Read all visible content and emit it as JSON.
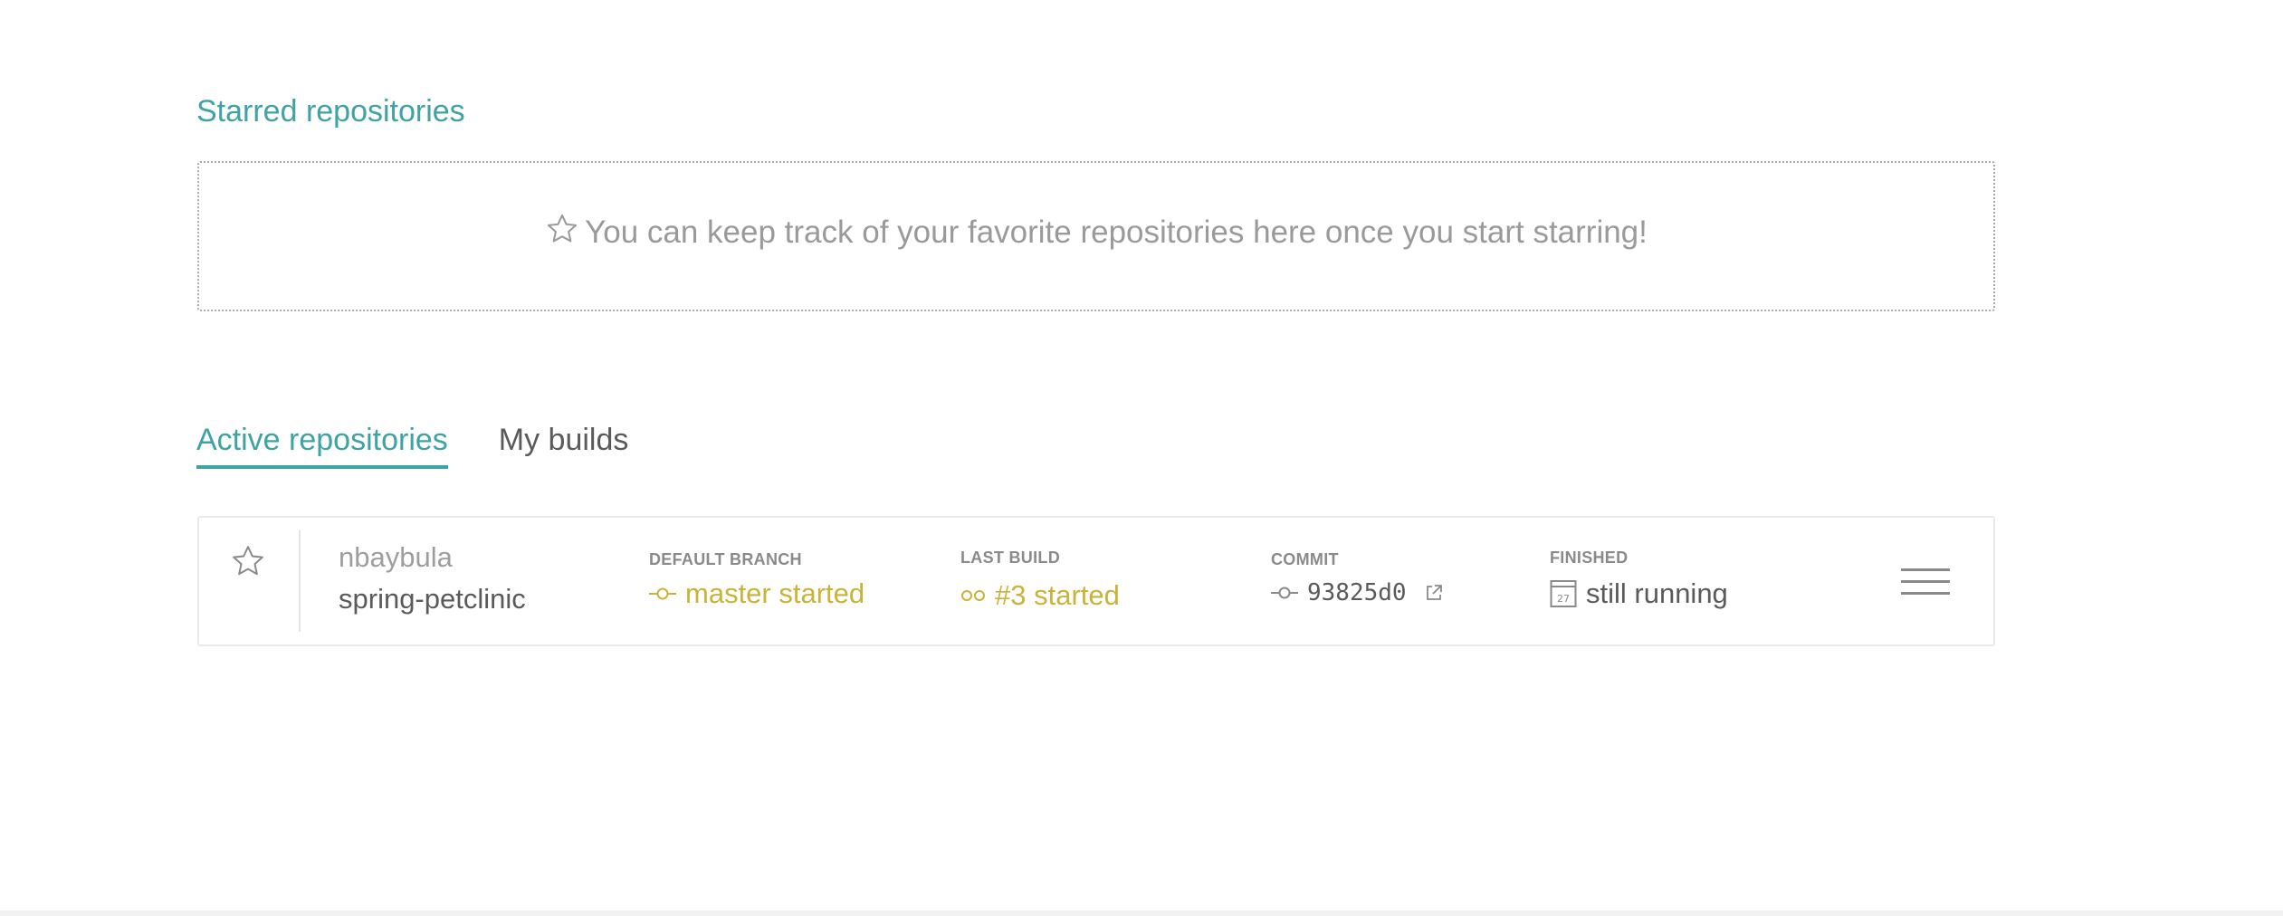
{
  "starred": {
    "title": "Starred repositories",
    "empty_message": "You can keep track of your favorite repositories here once you start starring!"
  },
  "tabs": [
    {
      "label": "Active repositories",
      "active": true
    },
    {
      "label": "My builds",
      "active": false
    }
  ],
  "repository": {
    "owner": "nbaybula",
    "name": "spring-petclinic",
    "default_branch_label": "DEFAULT BRANCH",
    "default_branch_value": "master started",
    "last_build_label": "LAST BUILD",
    "last_build_value": "#3 started",
    "commit_label": "COMMIT",
    "commit_value": "93825d0",
    "finished_label": "FINISHED",
    "finished_value": "still running",
    "calendar_day": "27",
    "status_color": "#c9b338"
  },
  "colors": {
    "accent": "#3fa2a3",
    "status_started": "#c9b338"
  },
  "icons": {
    "star": "star-icon",
    "branch": "branch-icon",
    "build": "build-icon",
    "commit": "commit-icon",
    "external_link": "external-link-icon",
    "calendar": "calendar-icon",
    "menu": "hamburger-menu-icon"
  }
}
